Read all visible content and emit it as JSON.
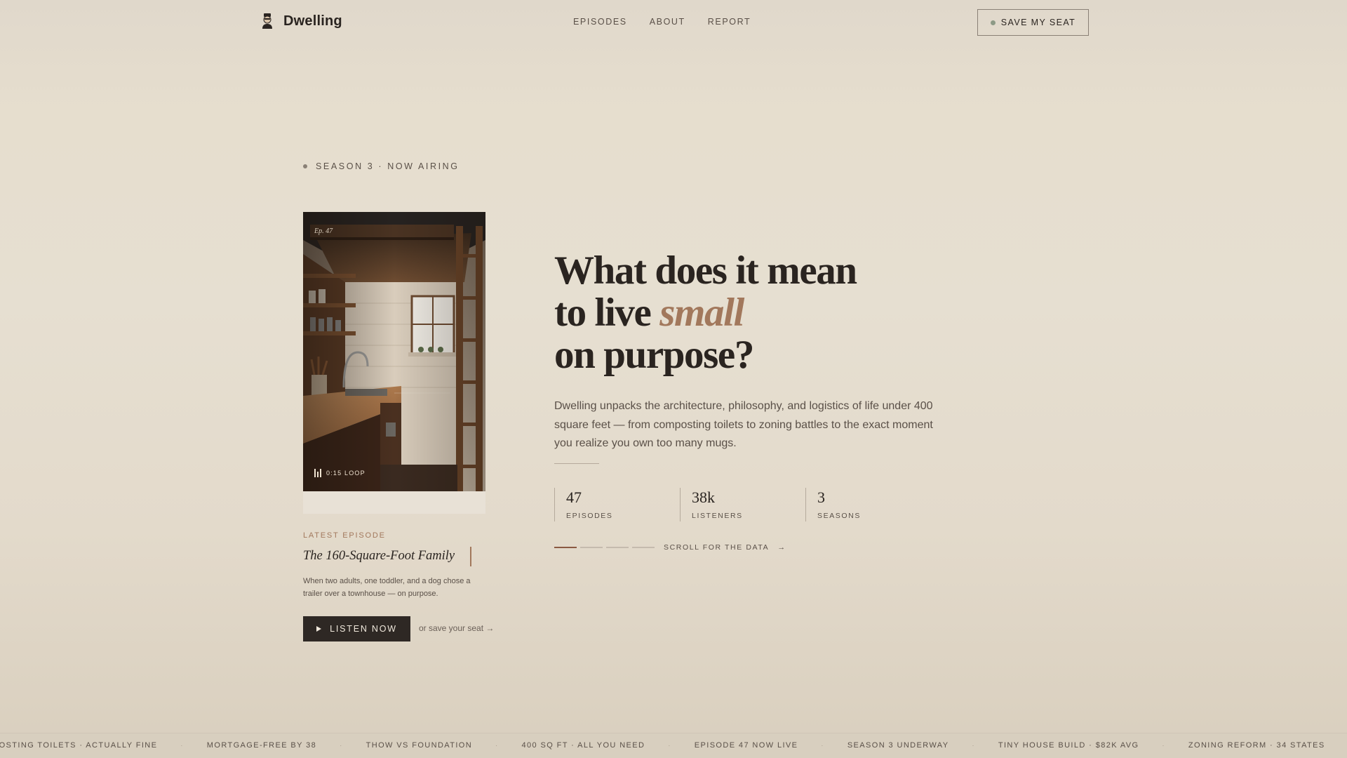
{
  "nav": {
    "brand": "Dwelling",
    "links": [
      "EPISODES",
      "ABOUT",
      "REPORT"
    ],
    "cta": "SAVE MY SEAT"
  },
  "hero": {
    "season_tag": "SEASON 3 · NOW AIRING",
    "headline_line1": "What does it mean",
    "headline_line2_pre": "to live ",
    "headline_line2_accent": "small",
    "headline_line3": "on purpose?",
    "lede": "Dwelling unpacks the architecture, philosophy, and logistics of life under 400 square feet — from composting toilets to zoning battles to the exact moment you realize you own too many mugs.",
    "stats": [
      {
        "value": "47",
        "label": "EPISODES"
      },
      {
        "value": "38k",
        "label": "LISTENERS"
      },
      {
        "value": "3",
        "label": "SEASONS"
      }
    ],
    "scroll_text": "SCROLL FOR THE DATA",
    "scroll_arrow": "→",
    "progress_active_index": 0
  },
  "episode_card": {
    "ep_tag": "Ep. 47",
    "loop_label": "0:15 LOOP",
    "latest_label": "LATEST EPISODE",
    "title": "The 160-Square-Foot Family",
    "description": "When two adults, one toddler, and a dog chose a trailer over a townhouse — on purpose.",
    "listen_label": "LISTEN NOW",
    "save_link": "or save your seat →"
  },
  "ticker": {
    "items": [
      "COMPOSTING TOILETS · ACTUALLY FINE",
      "MORTGAGE-FREE BY 38",
      "THOW VS FOUNDATION",
      "400 SQ FT · ALL YOU NEED",
      "EPISODE 47 NOW LIVE",
      "SEASON 3 UNDERWAY",
      "TINY HOUSE BUILD · $82K AVG",
      "ZONING REFORM · 34 STATES",
      "COMPOSTING TOILETS · ACTUALLY FINE"
    ],
    "separator": "·"
  },
  "colors": {
    "accent": "#a2785c",
    "ink": "#2a2420",
    "background": "#e6dfd1",
    "button": "#2e2824"
  }
}
